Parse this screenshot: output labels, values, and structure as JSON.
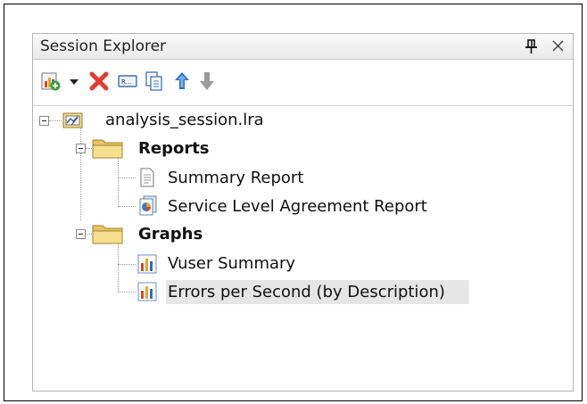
{
  "panel": {
    "title": "Session Explorer",
    "pin_icon": "pin-icon",
    "close_icon": "close-icon"
  },
  "toolbar": {
    "items": [
      {
        "name": "add-item-button",
        "icon": "add-graph-icon"
      },
      {
        "name": "add-dropdown-button",
        "icon": "dropdown-arrow-icon"
      },
      {
        "name": "delete-button",
        "icon": "red-x-icon"
      },
      {
        "name": "rename-button",
        "icon": "rename-icon"
      },
      {
        "name": "duplicate-button",
        "icon": "copy-icon"
      },
      {
        "name": "move-up-button",
        "icon": "up-arrow-icon"
      },
      {
        "name": "move-down-button",
        "icon": "down-arrow-icon"
      }
    ],
    "colors": {
      "delete": "#e53b2f",
      "up": "#2a6fd0",
      "down": "#9a9a9a"
    }
  },
  "tree": {
    "root": {
      "label": "analysis_session.lra",
      "icon": "session-icon"
    },
    "groups": [
      {
        "label": "Reports",
        "icon": "folder-icon",
        "children": [
          {
            "label": "Summary Report",
            "icon": "report-document-icon"
          },
          {
            "label": "Service Level Agreement Report",
            "icon": "sla-report-icon"
          }
        ]
      },
      {
        "label": "Graphs",
        "icon": "folder-icon",
        "children": [
          {
            "label": "Vuser Summary",
            "icon": "bar-graph-icon"
          },
          {
            "label": "Errors per Second (by Description)",
            "icon": "bar-graph-icon",
            "selected": true
          }
        ]
      }
    ]
  }
}
